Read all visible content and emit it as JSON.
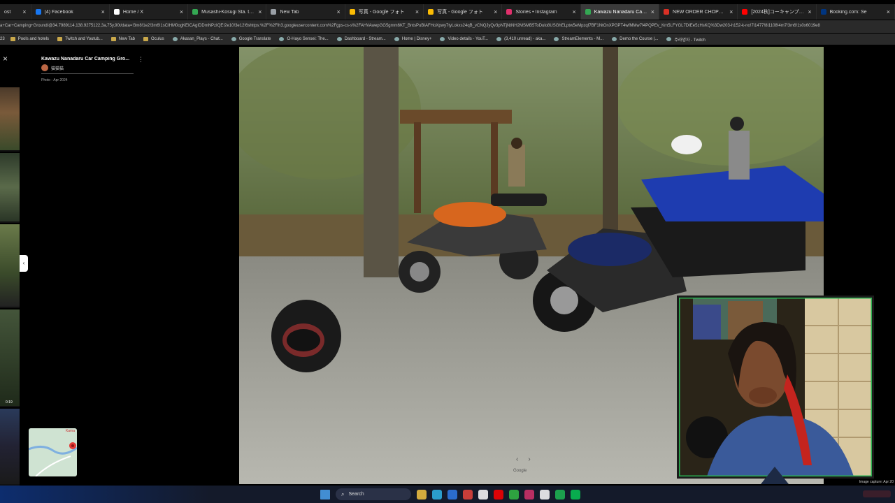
{
  "browser": {
    "tabs": [
      {
        "label": "ost",
        "icon": "generic-tab-icon",
        "color": "#888888"
      },
      {
        "label": "(4) Facebook",
        "icon": "facebook-icon",
        "color": "#1877f2"
      },
      {
        "label": "Home / X",
        "icon": "x-icon",
        "color": "#ffffff"
      },
      {
        "label": "Musashi-Kosugi Sta. to 1-chōm",
        "icon": "maps-pin-icon",
        "color": "#34a853"
      },
      {
        "label": "New Tab",
        "icon": "chrome-icon",
        "color": "#9aa0a6"
      },
      {
        "label": "写真 - Google フォト",
        "icon": "photos-icon",
        "color": "#fbbc04"
      },
      {
        "label": "写真 - Google フォト",
        "icon": "photos-icon",
        "color": "#fbbc04"
      },
      {
        "label": "Stories • Instagram",
        "icon": "instagram-icon",
        "color": "#e1306c"
      },
      {
        "label": "Kawazu Nanadaru Car Campin",
        "icon": "maps-pin-icon",
        "color": "#34a853",
        "active": true
      },
      {
        "label": "NEW ORDER CHOPPER SHOW",
        "icon": "red-square-icon",
        "color": "#d93025"
      },
      {
        "label": "[2024秋]コーキャンプ&スワップミ",
        "icon": "youtube-icon",
        "color": "#ff0000"
      },
      {
        "label": "Booking.com: Se",
        "icon": "booking-icon",
        "color": "#003580"
      }
    ],
    "close_glyph": "×",
    "address": "a+Car+Camping+Ground/@34.7989114,138.9275122,3a,75y,90t/data=!3m8!1e2!3m6!1sCIHM0ogKEICAgIDDmNPzIQE!2e10!3e12!6shttps:%2F%2Flh3.googleusercontent.com%2Fgps-cs-s%2FAHVAwepGG5gmm6KT_BntsPuBIAFHoXpwy7tyLokxs24qB_vCNQJyQv3pNTjNtNH2MSMB5ToDulo8USGhELptw5eMpzqf7BF1NtOnXPGPT4wfMMw7f4PQPEv_Km5LFYGL7DIEe5zHsKQ%3Dw203-h152-k-no!7i1477!8i1108!4m7!3m6!1s0x6019e8",
    "bookmarks": [
      "Pools and hotels",
      "Twitch and Youtub...",
      "New Tab",
      "Oculus",
      "Akasan_Plays - Chat...",
      "Google Translate",
      "O-Hayo Sensei: The...",
      "Dashboard - Stream...",
      "Home | Disney+",
      "Video details - YouT...",
      "(3,410 unread) - aka...",
      "StreamElements - M...",
      "Demo the Course |...",
      "주라멍자 - Twitch"
    ],
    "bookmark_prefix": "23"
  },
  "panel": {
    "close_glyph": "×",
    "title": "Kawazu Nanadaru Car Camping Gro...",
    "more_glyph": "⋮",
    "user": "猫猫猫",
    "date": "Photo - Apr 2024",
    "thumb_time": "0:19",
    "collapse_glyph": "‹",
    "minimap_label": "Kama"
  },
  "photo": {
    "nav_prev": "‹",
    "nav_next": "›",
    "watermark": "Google",
    "capture_note": "Image capture: Apr 20"
  },
  "taskbar": {
    "search_label": "Search",
    "search_glyph": "⌕",
    "icons": [
      {
        "name": "windows-start-icon",
        "color": "#4aa3f0"
      },
      {
        "name": "file-explorer-icon",
        "color": "#f4c542"
      },
      {
        "name": "edge-browser-icon",
        "color": "#2fb6e8"
      },
      {
        "name": "mail-icon",
        "color": "#2f7be8"
      },
      {
        "name": "chrome-icon",
        "color": "#e8453c"
      },
      {
        "name": "calendar-icon",
        "color": "#ffffff"
      },
      {
        "name": "youtube-icon",
        "color": "#ff0000"
      },
      {
        "name": "xbox-icon",
        "color": "#33bb44"
      },
      {
        "name": "slack-icon",
        "color": "#d6336c"
      },
      {
        "name": "github-icon",
        "color": "#ffffff"
      },
      {
        "name": "spotify-icon",
        "color": "#1db954"
      },
      {
        "name": "line-icon",
        "color": "#06c755"
      }
    ]
  }
}
